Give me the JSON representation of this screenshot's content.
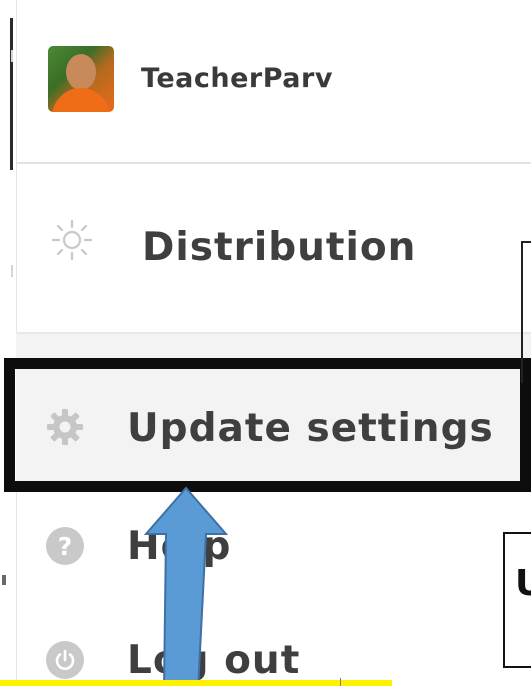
{
  "profile": {
    "username": "TeacherParv",
    "avatar_icon": "user-avatar"
  },
  "menu": {
    "items": [
      {
        "name": "distribution",
        "label": "Distribution",
        "icon": "sun-icon"
      },
      {
        "name": "update-settings",
        "label": "Update settings",
        "icon": "gear-icon"
      },
      {
        "name": "help",
        "label": "Help",
        "icon": "help-icon",
        "icon_text": "?"
      },
      {
        "name": "log-out",
        "label": "Log out",
        "icon": "power-icon"
      }
    ]
  },
  "annotations": {
    "highlight_color": "#0d0d0d",
    "arrow_color": "#5b9bd5",
    "right_glyph": "U",
    "band_color": "#fff200"
  }
}
